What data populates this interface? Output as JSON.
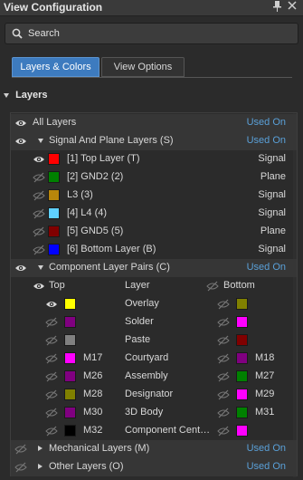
{
  "panel": {
    "title": "View Configuration",
    "pin_icon": "pin-icon",
    "close_icon": "close-icon"
  },
  "search": {
    "placeholder": "Search",
    "icon": "search-icon"
  },
  "tabs": [
    {
      "label": "Layers & Colors",
      "active": true
    },
    {
      "label": "View Options",
      "active": false
    }
  ],
  "layers_section": {
    "title": "Layers"
  },
  "all_layers": {
    "label": "All Layers",
    "status": "Used On"
  },
  "signal_plane": {
    "label": "Signal And Plane Layers (S)",
    "status": "Used On",
    "items": [
      {
        "name": "[1] Top Layer (T)",
        "color": "#ff0000",
        "type": "Signal",
        "visible": true
      },
      {
        "name": "[2] GND2 (2)",
        "color": "#008000",
        "type": "Plane",
        "visible": false
      },
      {
        "name": "L3 (3)",
        "color": "#b8860b",
        "type": "Signal",
        "visible": false
      },
      {
        "name": "[4] L4 (4)",
        "color": "#5fd0ff",
        "type": "Signal",
        "visible": false
      },
      {
        "name": "[5] GND5 (5)",
        "color": "#800000",
        "type": "Plane",
        "visible": false
      },
      {
        "name": "[6] Bottom Layer (B)",
        "color": "#0000ff",
        "type": "Signal",
        "visible": false
      }
    ]
  },
  "component_pairs": {
    "label": "Component Layer Pairs (C)",
    "status": "Used On",
    "col_top": "Top",
    "col_layer": "Layer",
    "col_bottom": "Bottom",
    "rows": [
      {
        "top_color": "#ffff00",
        "top_label": "",
        "layer": "Overlay",
        "bottom_color": "#808000",
        "bottom_label": "",
        "top_visible": true
      },
      {
        "top_color": "#800080",
        "top_label": "",
        "layer": "Solder",
        "bottom_color": "#ff00ff",
        "bottom_label": "",
        "top_visible": false
      },
      {
        "top_color": "#808080",
        "top_label": "",
        "layer": "Paste",
        "bottom_color": "#800000",
        "bottom_label": "",
        "top_visible": false
      },
      {
        "top_color": "#ff00ff",
        "top_label": "M17",
        "layer": "Courtyard",
        "bottom_color": "#800080",
        "bottom_label": "M18",
        "top_visible": false
      },
      {
        "top_color": "#800080",
        "top_label": "M26",
        "layer": "Assembly",
        "bottom_color": "#008000",
        "bottom_label": "M27",
        "top_visible": false
      },
      {
        "top_color": "#808000",
        "top_label": "M28",
        "layer": "Designator",
        "bottom_color": "#ff00ff",
        "bottom_label": "M29",
        "top_visible": false
      },
      {
        "top_color": "#800080",
        "top_label": "M30",
        "layer": "3D Body",
        "bottom_color": "#008000",
        "bottom_label": "M31",
        "top_visible": false
      },
      {
        "top_color": "#000000",
        "top_label": "M32",
        "layer": "Component Cent…",
        "bottom_color": "#ff00ff",
        "bottom_label": "",
        "top_visible": false
      }
    ]
  },
  "mechanical": {
    "label": "Mechanical Layers (M)",
    "status": "Used On"
  },
  "other": {
    "label": "Other Layers (O)",
    "status": "Used On"
  }
}
